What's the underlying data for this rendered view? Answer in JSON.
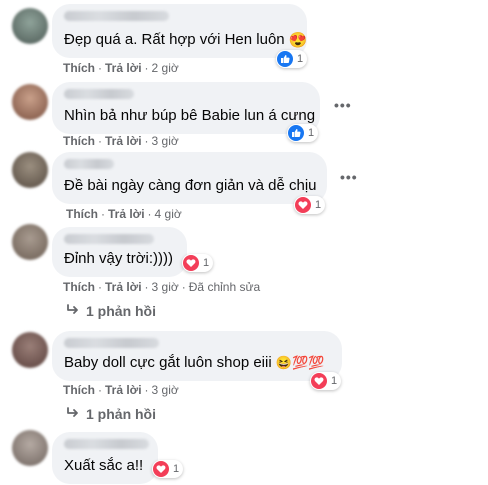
{
  "comments": [
    {
      "text": "Đẹp quá a. Rất hợp với Hen luôn",
      "emoji": "😍",
      "like": "Thích",
      "reply": "Trả lời",
      "time": "2 giờ",
      "reaction_icon": "like-icon",
      "reaction_count": "1"
    },
    {
      "text": "Nhìn bả như búp bê Babie lun á cưng",
      "like": "Thích",
      "reply": "Trả lời",
      "time": "3 giờ",
      "reaction_icon": "like-icon",
      "reaction_count": "1"
    },
    {
      "text": "Đề bài ngày càng đơn giản và dễ chịu",
      "like": "Thích",
      "reply": "Trả lời",
      "time": "4 giờ",
      "reaction_icon": "heart-icon",
      "reaction_count": "1"
    },
    {
      "text": "Đỉnh vậy trời:))))",
      "like": "Thích",
      "reply": "Trả lời",
      "time": "3 giờ",
      "edited": "Đã chỉnh sửa",
      "reaction_icon": "heart-icon",
      "reaction_count": "1",
      "replies": "1 phản hồi"
    },
    {
      "text": "Baby doll cực gắt luôn shop eiii",
      "emoji": "😆💯💯",
      "like": "Thích",
      "reply": "Trả lời",
      "time": "3 giờ",
      "reaction_icon": "heart-icon",
      "reaction_count": "1",
      "replies": "1 phản hồi"
    },
    {
      "text": "Xuất sắc a!!",
      "reaction_icon": "heart-icon",
      "reaction_count": "1"
    }
  ],
  "colors": {
    "bubble": "#f0f2f5",
    "meta": "#65676b",
    "like": "#1877f2",
    "heart": "#f33e58"
  }
}
